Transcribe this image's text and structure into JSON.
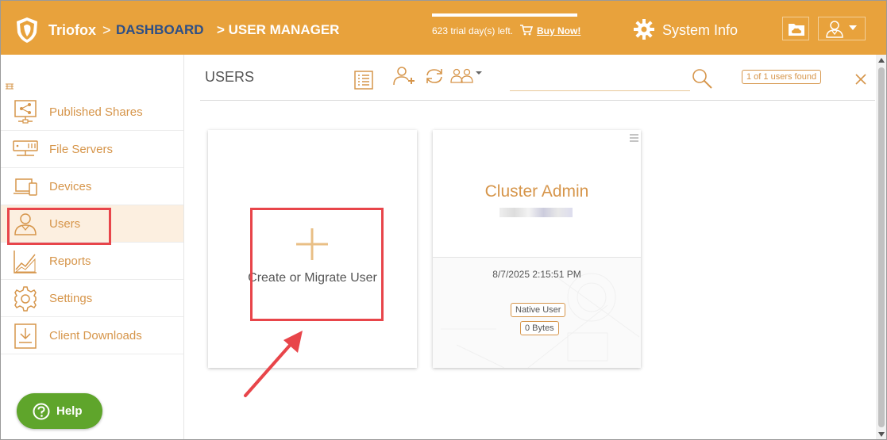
{
  "header": {
    "brand": "Triofox",
    "breadcrumb_sep": ">",
    "breadcrumb_dashboard": "DASHBOARD",
    "breadcrumb_current": "> USER MANAGER",
    "trial_text": "623 trial day(s) left.",
    "buy_now": "Buy Now!",
    "system_info": "System Info"
  },
  "sidebar": {
    "items": [
      {
        "label": "Published Shares",
        "icon": "published-shares-icon"
      },
      {
        "label": "File Servers",
        "icon": "file-servers-icon"
      },
      {
        "label": "Devices",
        "icon": "devices-icon"
      },
      {
        "label": "Users",
        "icon": "users-icon",
        "active": true
      },
      {
        "label": "Reports",
        "icon": "reports-icon"
      },
      {
        "label": "Settings",
        "icon": "settings-icon"
      },
      {
        "label": "Client Downloads",
        "icon": "client-downloads-icon"
      }
    ],
    "help_label": "Help"
  },
  "main": {
    "title": "USERS",
    "search_placeholder": "",
    "count_badge": "1 of 1 users found",
    "add_card_label": "Create or Migrate User",
    "user_card": {
      "name": "Cluster Admin",
      "date": "8/7/2025 2:15:51 PM",
      "type": "Native User",
      "size": "0 Bytes"
    }
  },
  "colors": {
    "header_bg": "#e8a23c",
    "accent": "#d6954a",
    "breadcrumb_link": "#2d4f86",
    "help_green": "#5fa52b",
    "highlight_red": "#e8454a"
  }
}
